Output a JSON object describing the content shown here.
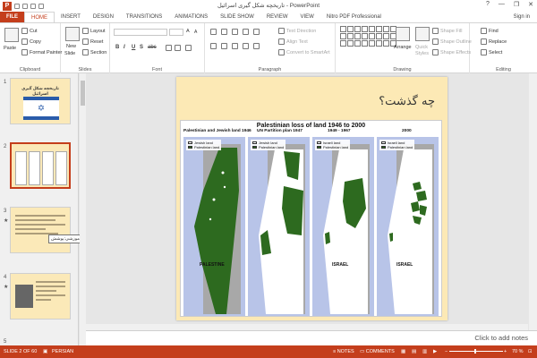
{
  "window": {
    "title": "تاریخچه شکل گیری اسرائیل - PowerPoint",
    "logo_letter": "P",
    "controls": [
      "?",
      "—",
      "❐",
      "✕"
    ],
    "sign_in": "Sign in"
  },
  "tabs": [
    {
      "label": "FILE"
    },
    {
      "label": "HOME"
    },
    {
      "label": "INSERT"
    },
    {
      "label": "DESIGN"
    },
    {
      "label": "TRANSITIONS"
    },
    {
      "label": "ANIMATIONS"
    },
    {
      "label": "SLIDE SHOW"
    },
    {
      "label": "REVIEW"
    },
    {
      "label": "VIEW"
    },
    {
      "label": "Nitro PDF Professional"
    }
  ],
  "ribbon": {
    "clipboard": {
      "label": "Clipboard",
      "paste": "Paste",
      "cut": "Cut",
      "copy": "Copy",
      "format_painter": "Format Painter"
    },
    "slides": {
      "label": "Slides",
      "new_slide": "New",
      "new_slide2": "Slide",
      "layout": "Layout",
      "reset": "Reset",
      "section": "Section"
    },
    "font": {
      "label": "Font",
      "bold": "B",
      "italic": "I",
      "underline": "U",
      "strike": "S",
      "shadow": "abc",
      "grow": "A",
      "shrink": "A"
    },
    "paragraph": {
      "label": "Paragraph",
      "text_direction": "Text Direction",
      "align_text": "Align Text",
      "smartart": "Convert to SmartArt"
    },
    "drawing": {
      "label": "Drawing",
      "arrange": "Arrange",
      "quick_styles": "Quick",
      "quick_styles2": "Styles",
      "shape_fill": "Shape Fill",
      "shape_outline": "Shape Outline",
      "shape_effects": "Shape Effects"
    },
    "editing": {
      "label": "Editing",
      "find": "Find",
      "replace": "Replace",
      "select": "Select"
    }
  },
  "thumbnails": [
    {
      "num": "1",
      "title": "تاریخچه شکل گیری اسرائیل"
    },
    {
      "num": "2"
    },
    {
      "num": "3",
      "star": "★"
    },
    {
      "num": "4",
      "star": "★"
    },
    {
      "num": "5"
    }
  ],
  "tooltip": "آموزشی:پوشش",
  "slide": {
    "title": "چه گذشت؟",
    "figure_title": "Palestinian loss of land 1946 to 2000",
    "maps": [
      {
        "heading": "Palestinian and Jewish land 1946",
        "legend1": "Jewish land",
        "legend2": "Palestinian land",
        "name": "PALESTINE"
      },
      {
        "heading": "UN Partition plan 1947",
        "legend1": "Jewish land",
        "legend2": "Palestinian land",
        "name": ""
      },
      {
        "heading": "1949 - 1967",
        "legend1": "Israeli land",
        "legend2": "Palestinian land",
        "name": "ISRAEL"
      },
      {
        "heading": "2000",
        "legend1": "Israeli land",
        "legend2": "Palestinian land",
        "name": "ISRAEL"
      }
    ]
  },
  "notes_placeholder": "Click to add notes",
  "status": {
    "slide_info": "SLIDE 2 OF 60",
    "language": "PERSIAN",
    "notes": "NOTES",
    "comments": "COMMENTS",
    "zoom": "70 %"
  },
  "colors": {
    "accent": "#c43e1c",
    "palestinian_land": "#2d6a1f",
    "israeli_land": "#ffffff",
    "sea": "#b8c4e8",
    "slide_bg": "#fce9b5"
  }
}
